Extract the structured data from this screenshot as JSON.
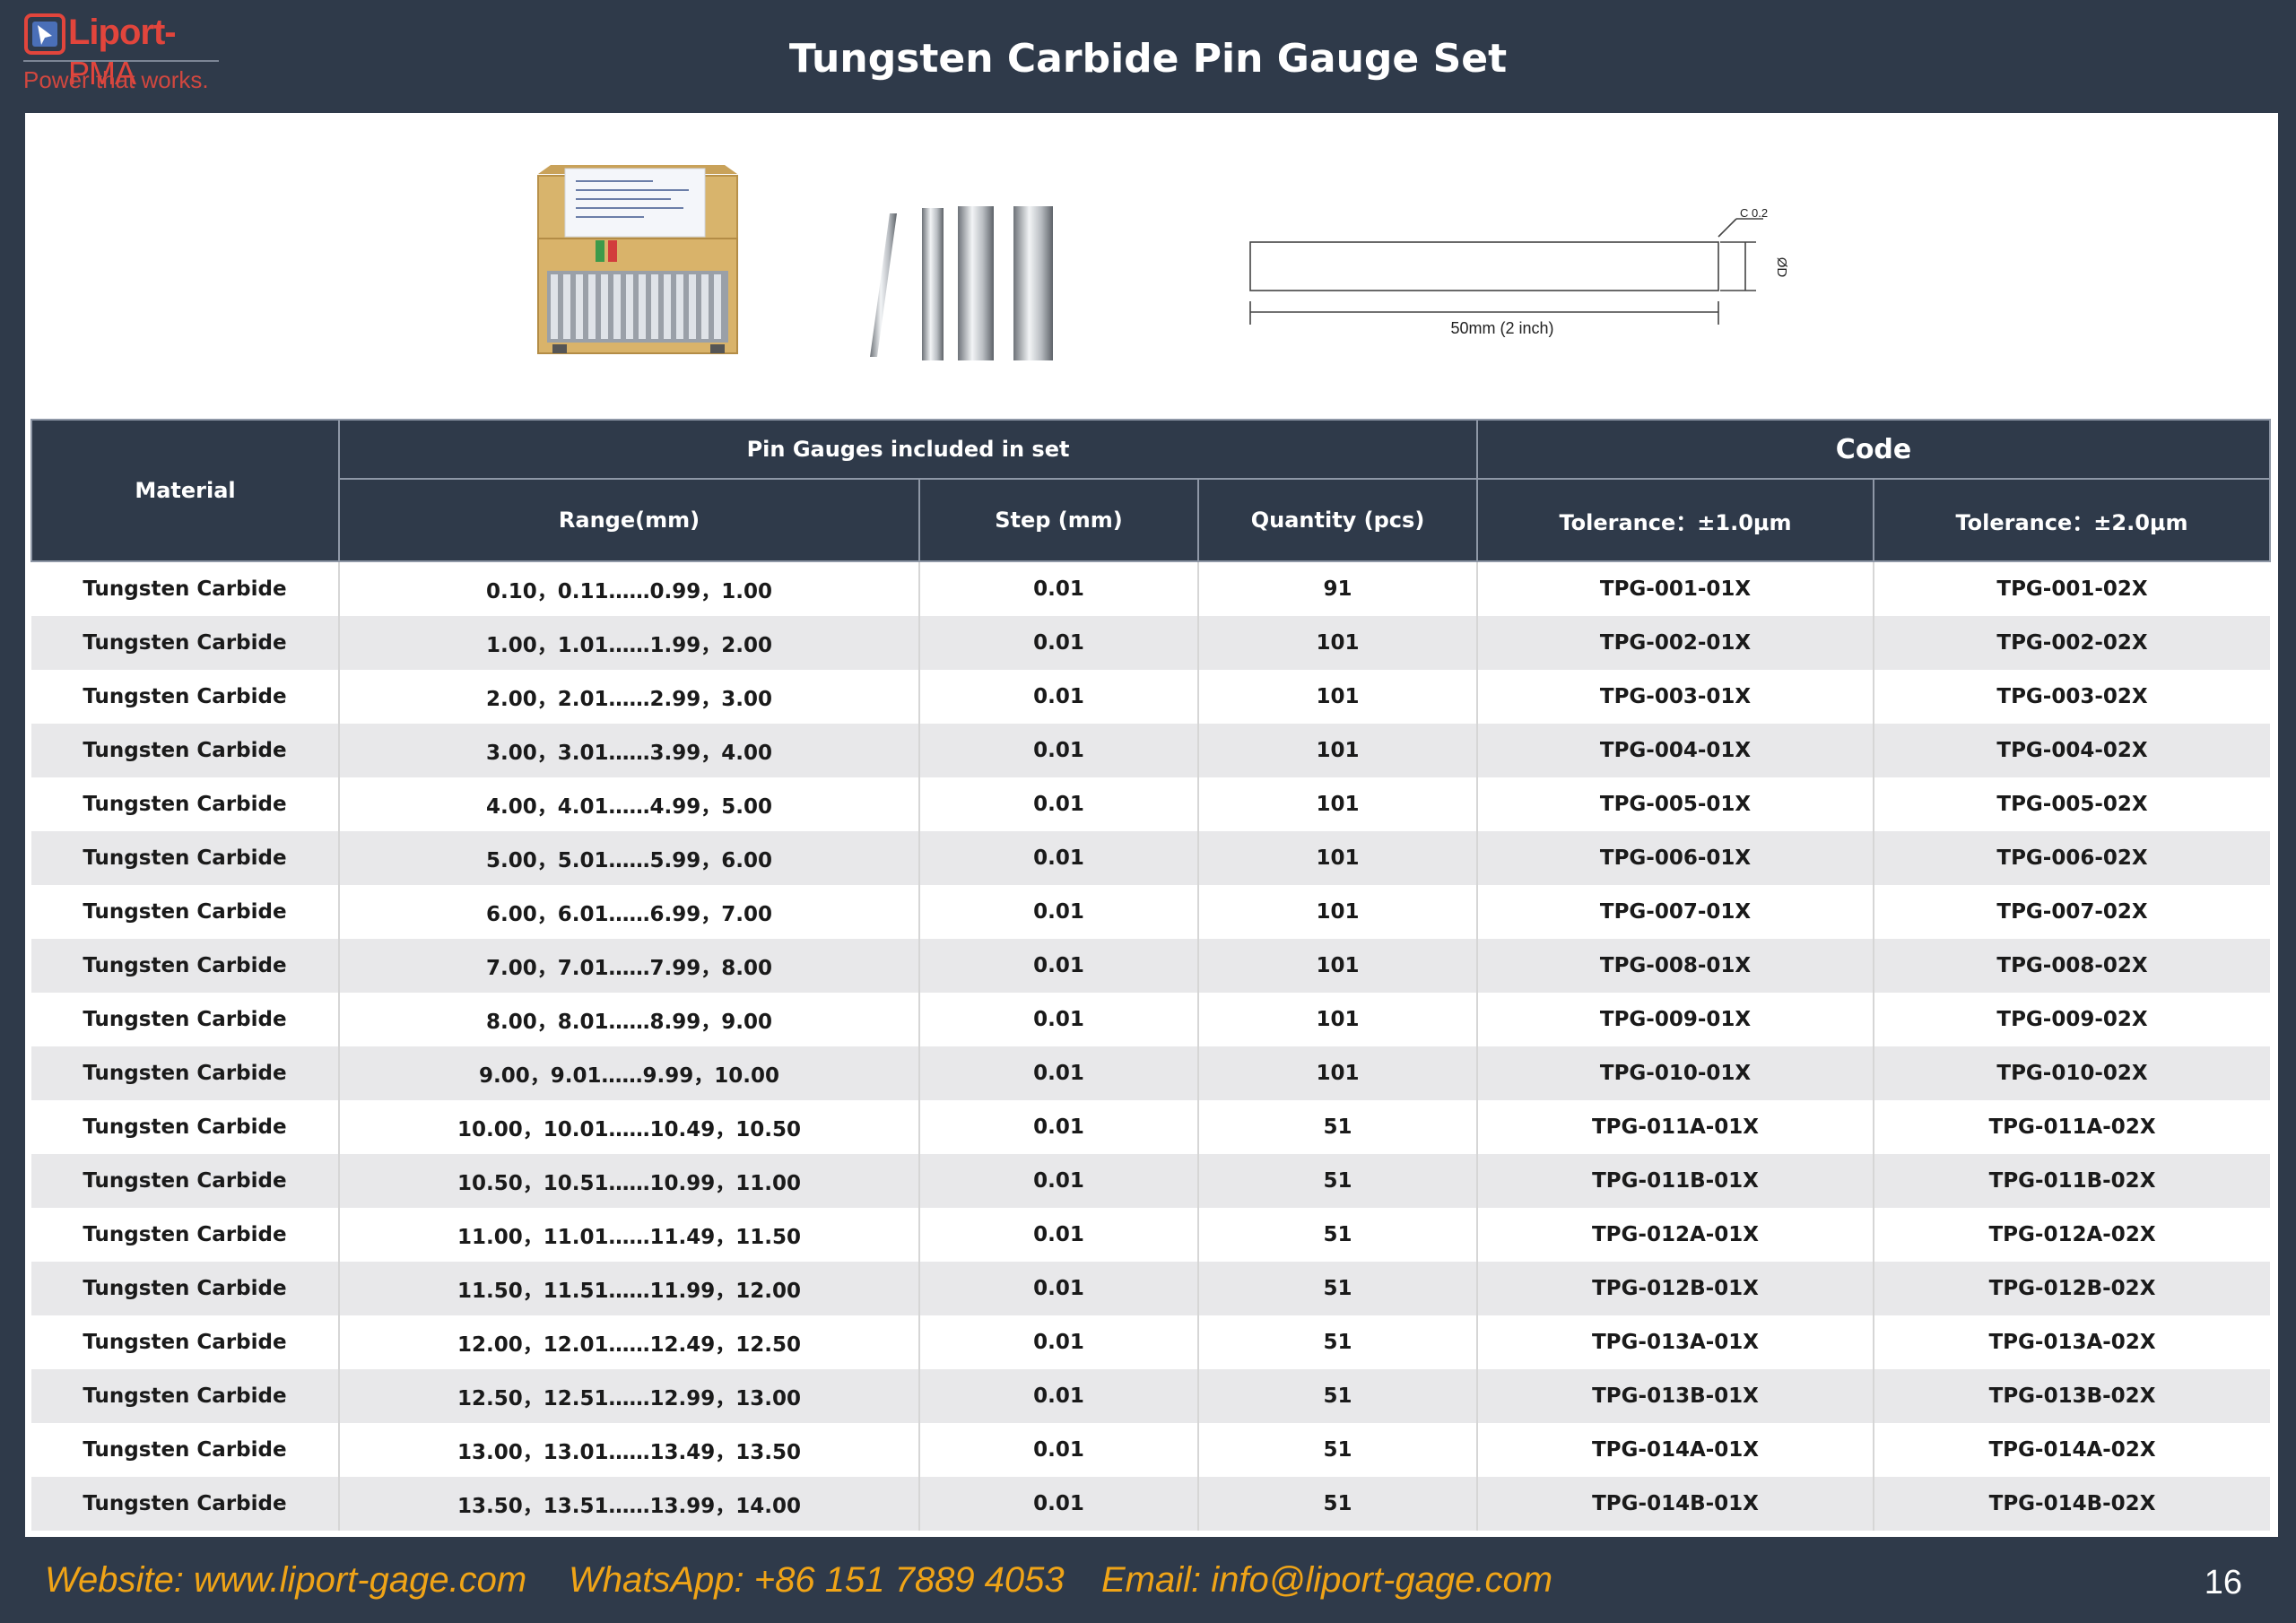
{
  "brand": {
    "name": "Liport-",
    "suffix": "PMA",
    "tagline": "Power that works."
  },
  "page_title": "Tungsten Carbide Pin Gauge Set",
  "drawing": {
    "chamfer_label": "C 0.2",
    "diameter_label": "ØD",
    "length_label": "50mm (2 inch)"
  },
  "table": {
    "header": {
      "material": "Material",
      "group_pins": "Pin Gauges included in set",
      "group_code": "Code",
      "range": "Range(mm)",
      "step": "Step (mm)",
      "quantity": "Quantity (pcs)",
      "tol1": "Tolerance：±1.0μm",
      "tol2": "Tolerance：±2.0μm"
    },
    "rows": [
      {
        "material": "Tungsten Carbide",
        "range": "0.10，0.11……0.99，1.00",
        "step": "0.01",
        "qty": "91",
        "code1": "TPG-001-01X",
        "code2": "TPG-001-02X"
      },
      {
        "material": "Tungsten Carbide",
        "range": "1.00，1.01……1.99，2.00",
        "step": "0.01",
        "qty": "101",
        "code1": "TPG-002-01X",
        "code2": "TPG-002-02X"
      },
      {
        "material": "Tungsten Carbide",
        "range": "2.00，2.01……2.99，3.00",
        "step": "0.01",
        "qty": "101",
        "code1": "TPG-003-01X",
        "code2": "TPG-003-02X"
      },
      {
        "material": "Tungsten Carbide",
        "range": "3.00，3.01……3.99，4.00",
        "step": "0.01",
        "qty": "101",
        "code1": "TPG-004-01X",
        "code2": "TPG-004-02X"
      },
      {
        "material": "Tungsten Carbide",
        "range": "4.00，4.01……4.99，5.00",
        "step": "0.01",
        "qty": "101",
        "code1": "TPG-005-01X",
        "code2": "TPG-005-02X"
      },
      {
        "material": "Tungsten Carbide",
        "range": "5.00，5.01……5.99，6.00",
        "step": "0.01",
        "qty": "101",
        "code1": "TPG-006-01X",
        "code2": "TPG-006-02X"
      },
      {
        "material": "Tungsten Carbide",
        "range": "6.00，6.01……6.99，7.00",
        "step": "0.01",
        "qty": "101",
        "code1": "TPG-007-01X",
        "code2": "TPG-007-02X"
      },
      {
        "material": "Tungsten Carbide",
        "range": "7.00，7.01……7.99，8.00",
        "step": "0.01",
        "qty": "101",
        "code1": "TPG-008-01X",
        "code2": "TPG-008-02X"
      },
      {
        "material": "Tungsten Carbide",
        "range": "8.00，8.01……8.99，9.00",
        "step": "0.01",
        "qty": "101",
        "code1": "TPG-009-01X",
        "code2": "TPG-009-02X"
      },
      {
        "material": "Tungsten Carbide",
        "range": "9.00，9.01……9.99，10.00",
        "step": "0.01",
        "qty": "101",
        "code1": "TPG-010-01X",
        "code2": "TPG-010-02X"
      },
      {
        "material": "Tungsten Carbide",
        "range": "10.00，10.01……10.49，10.50",
        "step": "0.01",
        "qty": "51",
        "code1": "TPG-011A-01X",
        "code2": "TPG-011A-02X"
      },
      {
        "material": "Tungsten Carbide",
        "range": "10.50，10.51……10.99，11.00",
        "step": "0.01",
        "qty": "51",
        "code1": "TPG-011B-01X",
        "code2": "TPG-011B-02X"
      },
      {
        "material": "Tungsten Carbide",
        "range": "11.00，11.01……11.49，11.50",
        "step": "0.01",
        "qty": "51",
        "code1": "TPG-012A-01X",
        "code2": "TPG-012A-02X"
      },
      {
        "material": "Tungsten Carbide",
        "range": "11.50，11.51……11.99，12.00",
        "step": "0.01",
        "qty": "51",
        "code1": "TPG-012B-01X",
        "code2": "TPG-012B-02X"
      },
      {
        "material": "Tungsten Carbide",
        "range": "12.00，12.01……12.49，12.50",
        "step": "0.01",
        "qty": "51",
        "code1": "TPG-013A-01X",
        "code2": "TPG-013A-02X"
      },
      {
        "material": "Tungsten Carbide",
        "range": "12.50，12.51……12.99，13.00",
        "step": "0.01",
        "qty": "51",
        "code1": "TPG-013B-01X",
        "code2": "TPG-013B-02X"
      },
      {
        "material": "Tungsten Carbide",
        "range": "13.00，13.01……13.49，13.50",
        "step": "0.01",
        "qty": "51",
        "code1": "TPG-014A-01X",
        "code2": "TPG-014A-02X"
      },
      {
        "material": "Tungsten Carbide",
        "range": "13.50，13.51……13.99，14.00",
        "step": "0.01",
        "qty": "51",
        "code1": "TPG-014B-01X",
        "code2": "TPG-014B-02X"
      }
    ]
  },
  "footer": {
    "website": "Website: www.liport-gage.com",
    "whatsapp": "WhatsApp: +86 151 7889 4053",
    "email": "Email: info@liport-gage.com",
    "page_number": "16"
  },
  "colors": {
    "background": "#2f3a4a",
    "brand_red": "#e2453c",
    "footer_orange": "#f0a417",
    "row_alt": "#e8e8ea"
  }
}
